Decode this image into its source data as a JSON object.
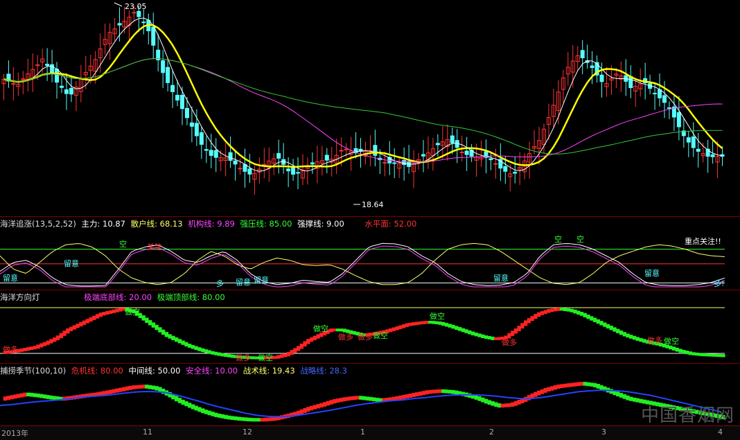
{
  "price_panel": {
    "high_label": "23.05",
    "low_label": "18.64"
  },
  "haiyang_zhuizhang": {
    "name": "海洋追涨(13,5,2,52)",
    "zhuli": "主力: 10.87",
    "sanhu": "散户线: 68.13",
    "jigou": "机构线: 9.89",
    "qiangya": "强压线: 85.00",
    "qiangcheng": "强撑线: 9.00",
    "shuiping": "水平面: 52.00",
    "annotations": [
      "留意",
      "留意",
      "多",
      "留意",
      "留意",
      "空",
      "关注",
      "空",
      "空",
      "留意",
      "留意",
      "多!",
      "重点关注!!"
    ],
    "colors": {
      "zhuli": "#ffffff",
      "sanhu": "#ffff66",
      "jigou": "#ff44ff",
      "qiangya": "#33ff33",
      "qiangcheng": "#ffffff",
      "shuiping": "#ff3333"
    }
  },
  "haiyang_fangxiangdeng": {
    "name": "海洋方向灯",
    "low_line": "极端底部线: 20.00",
    "high_line": "极端顶部线: 80.00",
    "annotations": [
      "做多",
      "做空",
      "做空",
      "做多",
      "做空",
      "做空",
      "做多",
      "做空",
      "做多",
      "做多",
      "做多",
      "做空"
    ]
  },
  "bulao_jijie": {
    "name": "捕捞季节(100,10)",
    "weiji": "危机线: 80.00",
    "zhongjian": "中间线: 50.00",
    "anquan": "安全线: 10.00",
    "zhanshu": "战术线: 19.43",
    "zhanlue": "战略线: 28.3"
  },
  "x_axis": {
    "labels": [
      "2013年",
      "11",
      "12",
      "1",
      "2",
      "3",
      "4"
    ]
  },
  "watermark": "中国香烟网",
  "chart_data": [
    {
      "type": "candlestick",
      "title": "",
      "price_high": 23.05,
      "price_low": 18.64,
      "up_color": "#ff3333",
      "down_color": "#55ffff",
      "ma_colors": [
        "#ffffff",
        "#ffff00",
        "#ff44ff",
        "#33cc33"
      ],
      "close_path": [
        21.4,
        21.2,
        21.6,
        21.9,
        21.3,
        21.0,
        21.5,
        21.8,
        22.4,
        22.7,
        22.9,
        22.5,
        21.7,
        21.1,
        20.5,
        20.0,
        19.7,
        19.6,
        19.4,
        19.3,
        19.5,
        19.6,
        19.3,
        19.4,
        19.5,
        19.6,
        19.9,
        19.7,
        19.8,
        19.6,
        19.5,
        19.4,
        19.7,
        19.9,
        20.0,
        19.8,
        19.7,
        19.6,
        19.4,
        19.3,
        19.6,
        20.0,
        20.8,
        21.6,
        21.9,
        21.7,
        21.3,
        21.5,
        21.2,
        21.4,
        21.0,
        20.7,
        20.2,
        19.8,
        19.6,
        19.7
      ]
    },
    {
      "type": "line",
      "title": "",
      "ylim": [
        0,
        100
      ],
      "series": [
        {
          "name": "主力",
          "values": [
            35,
            55,
            60,
            45,
            20,
            5,
            2,
            2,
            3,
            40,
            80,
            90,
            95,
            80,
            60,
            55,
            70,
            80,
            60,
            30,
            12,
            5,
            8,
            15,
            12,
            10,
            30,
            60,
            90,
            98,
            97,
            90,
            70,
            55,
            30,
            12,
            5,
            3,
            4,
            10,
            30,
            70,
            95,
            98,
            95,
            85,
            70,
            55,
            30,
            10,
            4,
            3,
            3,
            5,
            10,
            20
          ]
        },
        {
          "name": "散户线",
          "values": [
            70,
            40,
            30,
            55,
            80,
            95,
            98,
            90,
            70,
            40,
            20,
            10,
            5,
            10,
            30,
            60,
            80,
            70,
            50,
            40,
            55,
            65,
            60,
            50,
            48,
            50,
            40,
            25,
            12,
            5,
            5,
            10,
            30,
            60,
            85,
            95,
            98,
            95,
            80,
            60,
            40,
            20,
            8,
            5,
            10,
            30,
            55,
            70,
            80,
            90,
            95,
            92,
            85,
            75,
            70,
            68
          ]
        }
      ],
      "hlines": [
        85,
        9,
        52
      ]
    },
    {
      "type": "area",
      "title": "",
      "ylim": [
        0,
        100
      ],
      "values": [
        12,
        14,
        18,
        22,
        30,
        40,
        55,
        65,
        75,
        85,
        90,
        95,
        90,
        75,
        60,
        45,
        35,
        25,
        18,
        12,
        8,
        5,
        3,
        2,
        2,
        3,
        8,
        20,
        35,
        45,
        55,
        55,
        50,
        45,
        48,
        52,
        58,
        65,
        68,
        70,
        68,
        62,
        55,
        48,
        42,
        38,
        40,
        55,
        72,
        85,
        92,
        95,
        92,
        85,
        75,
        65,
        55,
        45,
        38,
        32,
        28,
        22,
        15,
        10,
        8,
        7,
        6
      ],
      "hlines": [
        80,
        20
      ]
    },
    {
      "type": "area",
      "title": "",
      "ylim": [
        0,
        100
      ],
      "values": [
        55,
        60,
        65,
        62,
        58,
        55,
        58,
        62,
        65,
        70,
        75,
        80,
        82,
        78,
        65,
        50,
        38,
        28,
        20,
        15,
        12,
        10,
        10,
        12,
        18,
        25,
        35,
        42,
        50,
        55,
        58,
        55,
        52,
        55,
        60,
        65,
        70,
        72,
        70,
        65,
        58,
        48,
        40,
        42,
        52,
        65,
        75,
        82,
        85,
        88,
        85,
        75,
        65,
        55,
        50,
        45,
        40,
        35,
        30,
        25,
        20,
        15
      ],
      "series": [
        {
          "name": "战略线",
          "values": [
            40,
            42,
            45,
            48,
            50,
            52,
            55,
            58,
            60,
            62,
            65,
            68,
            70,
            70,
            68,
            62,
            55,
            48,
            40,
            34,
            28,
            22,
            18,
            16,
            16,
            18,
            22,
            26,
            30,
            35,
            40,
            44,
            47,
            50,
            52,
            55,
            57,
            60,
            62,
            63,
            63,
            62,
            60,
            57,
            55,
            55,
            58,
            62,
            66,
            70,
            72,
            73,
            72,
            70,
            66,
            62,
            56,
            50,
            44,
            38,
            32,
            26
          ]
        }
      ],
      "hlines": [
        80,
        50,
        10
      ]
    }
  ]
}
